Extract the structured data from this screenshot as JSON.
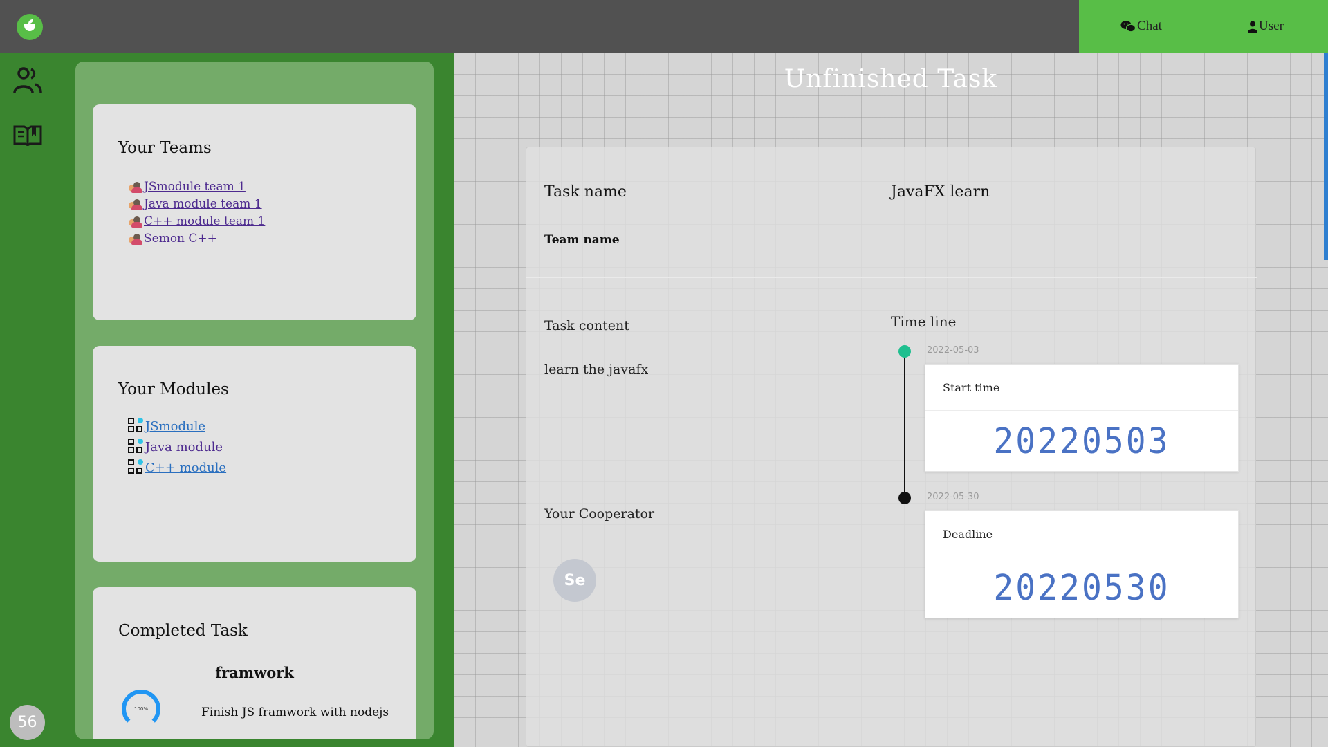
{
  "header": {
    "nav": [
      {
        "label": "Chat",
        "icon": "wechat-icon"
      },
      {
        "label": "User",
        "icon": "user-icon"
      }
    ]
  },
  "rail": {
    "icons": [
      "users-icon",
      "book-icon"
    ],
    "badge": "56"
  },
  "sidebar": {
    "teams": {
      "title": "Your Teams",
      "items": [
        "JSmodule team 1",
        "Java module team 1",
        "C++ module team 1",
        "Semon C++"
      ]
    },
    "modules": {
      "title": "Your Modules",
      "items": [
        "JSmodule",
        "Java module",
        "C++ module"
      ]
    },
    "completed": {
      "title": "Completed Task",
      "task_title": "framwork",
      "progress_label": "100%",
      "progress": 1.0,
      "description": "Finish JS framwork with nodejs"
    }
  },
  "main": {
    "title": "Unfinished Task",
    "task": {
      "name_label": "Task name",
      "name_value": "JavaFX learn",
      "team_label": "Team name",
      "content_label": "Task content",
      "content_value": "learn the javafx",
      "cooperator_label": "Your Cooperator",
      "cooperator_initials": "Se",
      "timeline_label": "Time line",
      "timeline": [
        {
          "date": "2022-05-03",
          "title": "Start time",
          "value": "20220503",
          "dot_color": "#1fbf8f"
        },
        {
          "date": "2022-05-30",
          "title": "Deadline",
          "value": "20220530",
          "dot_color": "#111111"
        }
      ]
    }
  },
  "colors": {
    "topbar": "#515151",
    "accent_green": "#58be47",
    "sidebar_green": "#3a852f",
    "panel_green": "#74ab69",
    "digit_blue": "#4a72c4"
  }
}
